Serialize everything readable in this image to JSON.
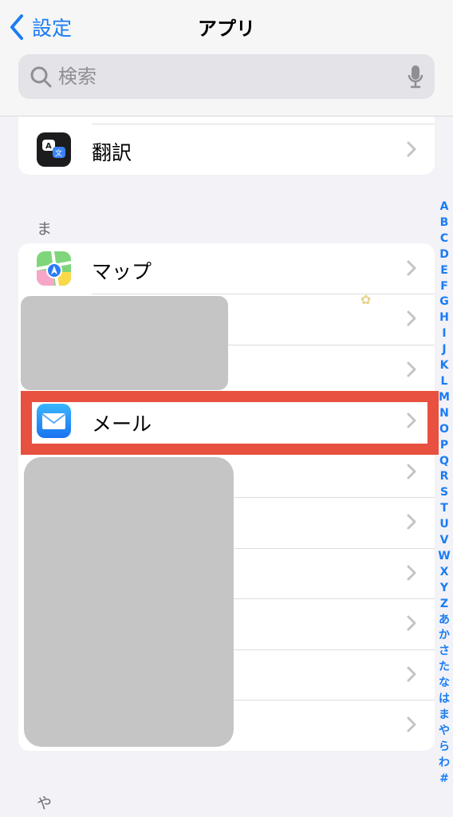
{
  "nav": {
    "back_label": "設定",
    "title": "アプリ"
  },
  "search": {
    "placeholder": "検索"
  },
  "sections": [
    {
      "header": "",
      "items": [
        {
          "label": "翻訳",
          "icon": "translate-icon"
        }
      ]
    },
    {
      "header": "ま",
      "items": [
        {
          "label": "マップ",
          "icon": "maps-icon"
        },
        {
          "label": "",
          "icon": ""
        },
        {
          "label": "",
          "icon": ""
        },
        {
          "label": "メール",
          "icon": "mail-icon"
        },
        {
          "label": "",
          "icon": ""
        },
        {
          "label": "",
          "icon": ""
        },
        {
          "label": "",
          "icon": ""
        },
        {
          "label": "",
          "icon": ""
        },
        {
          "label": "",
          "icon": ""
        },
        {
          "label": "",
          "icon": ""
        }
      ]
    },
    {
      "header": "や",
      "items": []
    }
  ],
  "index": [
    "A",
    "B",
    "C",
    "D",
    "E",
    "F",
    "G",
    "H",
    "I",
    "J",
    "K",
    "L",
    "M",
    "N",
    "O",
    "P",
    "Q",
    "R",
    "S",
    "T",
    "U",
    "V",
    "W",
    "X",
    "Y",
    "Z",
    "あ",
    "か",
    "さ",
    "た",
    "な",
    "は",
    "ま",
    "や",
    "ら",
    "わ",
    "#"
  ],
  "highlight_color": "#e8503f",
  "accent_color": "#1a7cf5"
}
